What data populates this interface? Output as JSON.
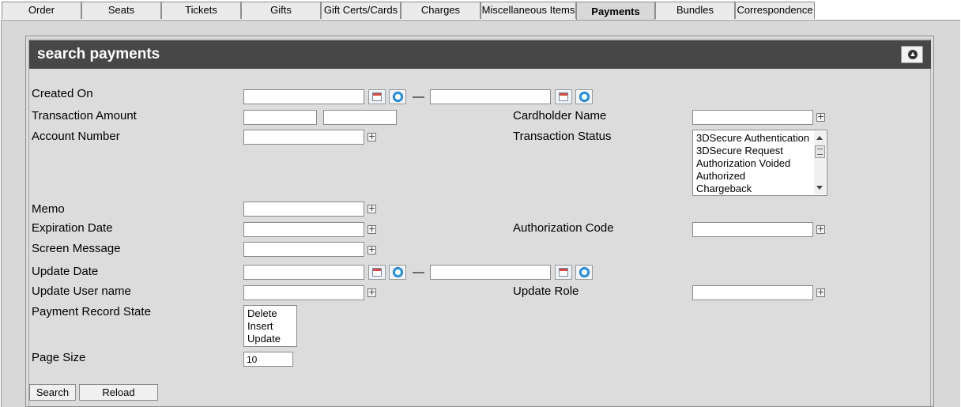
{
  "tabs": [
    {
      "label": "Order"
    },
    {
      "label": "Seats"
    },
    {
      "label": "Tickets"
    },
    {
      "label": "Gifts"
    },
    {
      "label": "Gift Certs/Cards"
    },
    {
      "label": "Charges"
    },
    {
      "label": "Miscellaneous Items"
    },
    {
      "label": "Payments",
      "active": true
    },
    {
      "label": "Bundles"
    },
    {
      "label": "Correspondence"
    }
  ],
  "panel": {
    "title": "search payments",
    "collapse_icon": "collapse-up-icon"
  },
  "form": {
    "created_on": {
      "label": "Created On",
      "separator": "—"
    },
    "transaction_amount": {
      "label": "Transaction Amount"
    },
    "cardholder_name": {
      "label": "Cardholder Name"
    },
    "account_number": {
      "label": "Account Number"
    },
    "transaction_status": {
      "label": "Transaction Status",
      "options": [
        "3DSecure Authentication",
        "3DSecure Request",
        "Authorization Voided",
        "Authorized",
        "Chargeback"
      ]
    },
    "memo": {
      "label": "Memo"
    },
    "expiration_date": {
      "label": "Expiration Date"
    },
    "authorization_code": {
      "label": "Authorization Code"
    },
    "screen_message": {
      "label": "Screen Message"
    },
    "update_date": {
      "label": "Update Date",
      "separator": "—"
    },
    "update_user_name": {
      "label": "Update User name"
    },
    "update_role": {
      "label": "Update Role"
    },
    "payment_record_state": {
      "label": "Payment Record State",
      "options": [
        "Delete",
        "Insert",
        "Update"
      ]
    },
    "page_size": {
      "label": "Page Size",
      "value": "10"
    }
  },
  "buttons": {
    "search": "Search",
    "reload": "Reload"
  },
  "icons": {
    "calendar": "calendar-icon",
    "clock": "clock-icon",
    "add": "plus-icon"
  }
}
